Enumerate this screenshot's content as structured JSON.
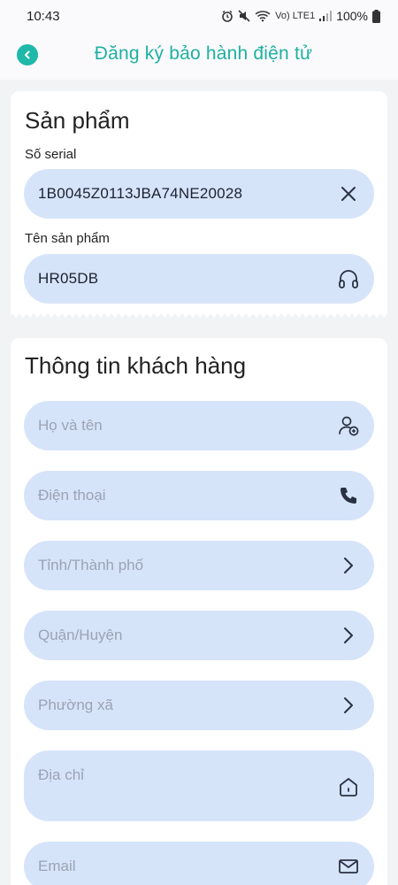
{
  "status_bar": {
    "time": "10:43",
    "signal_label": "Vo) LTE1",
    "battery": "100%"
  },
  "app_bar": {
    "title": "Đăng ký bảo hành điện tử",
    "back_icon": "chevron-left-icon"
  },
  "product": {
    "section_title": "Sản phẩm",
    "serial_label": "Số serial",
    "serial_value": "1B0045Z0113JBA74NE20028",
    "serial_icon": "clear-icon",
    "name_label": "Tên sản phẩm",
    "name_value": "HR05DB",
    "name_icon": "headphones-icon"
  },
  "customer": {
    "section_title": "Thông tin khách hàng",
    "fields": [
      {
        "placeholder": "Họ và tên",
        "icon": "add-person-icon"
      },
      {
        "placeholder": "Điện thoại",
        "icon": "phone-icon"
      },
      {
        "placeholder": "Tỉnh/Thành phố",
        "icon": "chevron-right-icon"
      },
      {
        "placeholder": "Quận/Huyện",
        "icon": "chevron-right-icon"
      },
      {
        "placeholder": "Phường xã",
        "icon": "chevron-right-icon"
      },
      {
        "placeholder": "Địa chỉ",
        "icon": "home-icon"
      },
      {
        "placeholder": "Email",
        "icon": "mail-icon"
      }
    ]
  },
  "colors": {
    "accent": "#1fb0a2",
    "field_bg": "#d6e4fa",
    "page_bg": "#f2f3f5"
  }
}
